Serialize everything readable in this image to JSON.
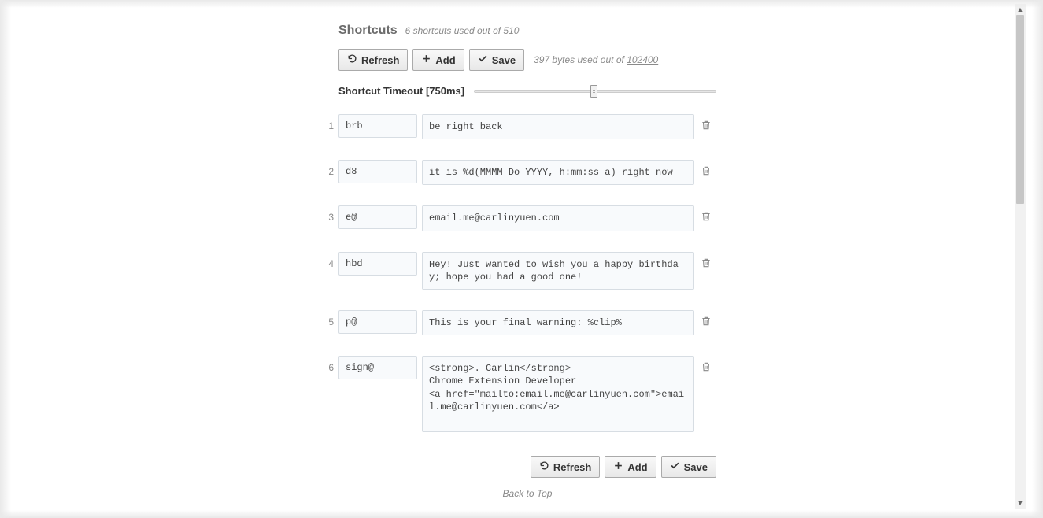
{
  "header": {
    "title": "Shortcuts",
    "count_text": "6 shortcuts used out of 510"
  },
  "toolbar": {
    "refresh_label": "Refresh",
    "add_label": "Add",
    "save_label": "Save",
    "bytes_prefix": "397 bytes used out of ",
    "bytes_link": "102400"
  },
  "timeout": {
    "label": "Shortcut Timeout [750ms]"
  },
  "rows": [
    {
      "n": "1",
      "key": "brb",
      "val": "be right back",
      "lines": 1
    },
    {
      "n": "2",
      "key": "d8",
      "val": "it is %d(MMMM Do YYYY, h:mm:ss a) right now",
      "lines": 1
    },
    {
      "n": "3",
      "key": "e@",
      "val": "email.me@carlinyuen.com",
      "lines": 1
    },
    {
      "n": "4",
      "key": "hbd",
      "val": "Hey! Just wanted to wish you a happy birthday; hope you had a good one!",
      "lines": 2
    },
    {
      "n": "5",
      "key": "p@",
      "val": "This is your final warning: %clip%",
      "lines": 1
    },
    {
      "n": "6",
      "key": "sign@",
      "val": "<strong>. Carlin</strong>\nChrome Extension Developer\n<a href=\"mailto:email.me@carlinyuen.com\">email.me@carlinyuen.com</a>",
      "lines": 5
    }
  ],
  "footer": {
    "back_label": "Back to Top"
  }
}
